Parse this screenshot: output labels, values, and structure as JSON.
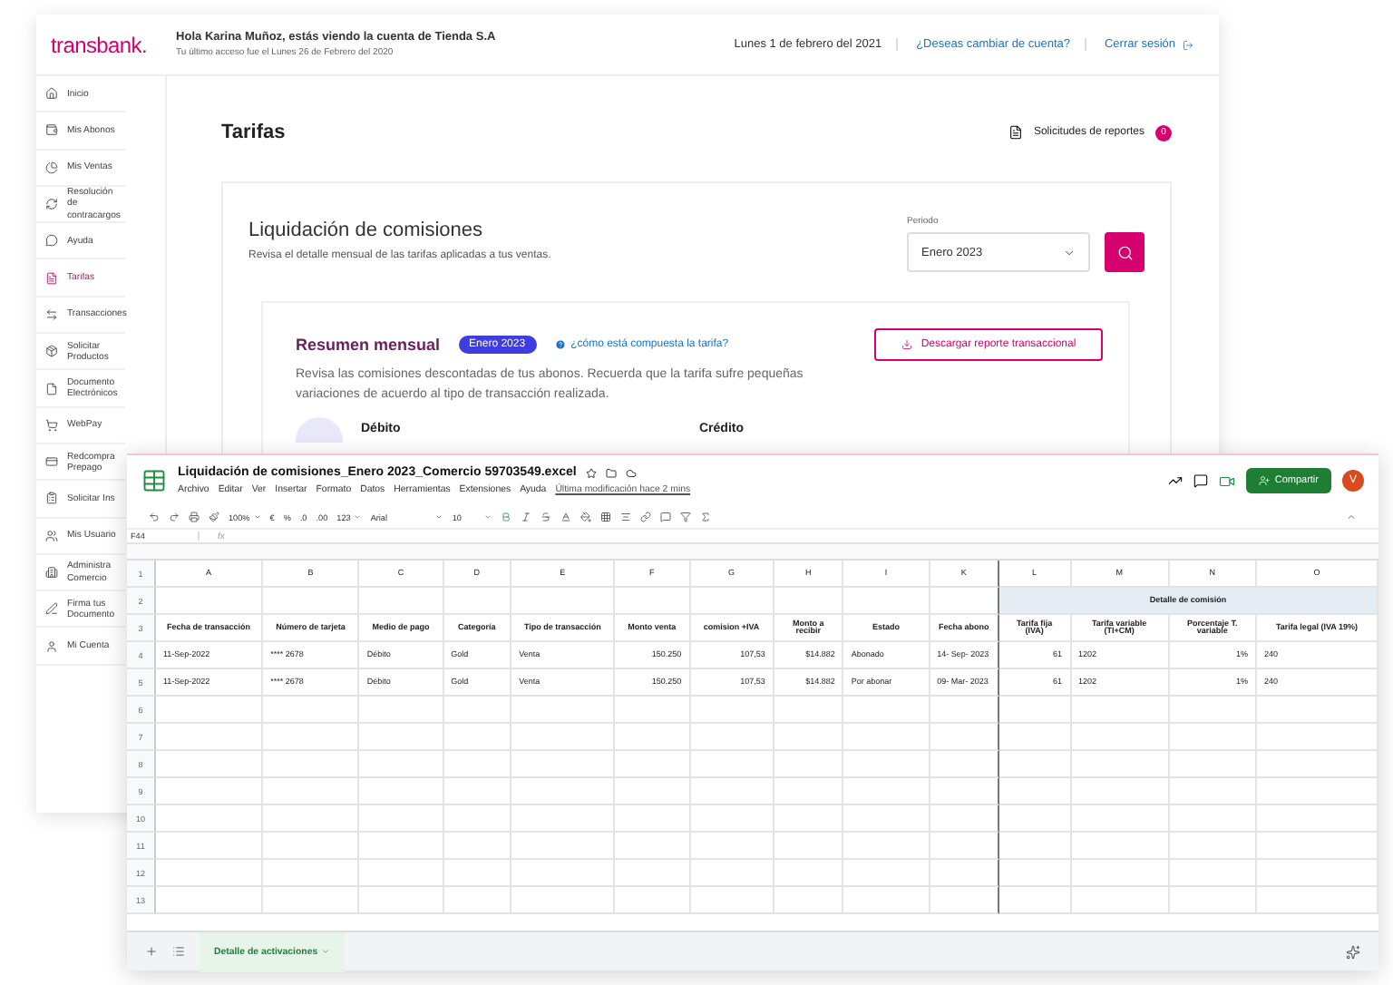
{
  "portal": {
    "logo": "transbank.",
    "greeting": "Hola Karina Muñoz, estás viendo la cuenta de Tienda S.A",
    "last_access": "Tu último acceso fue el Lunes 26 de Febrero del 2020",
    "date": "Lunes 1 de febrero del 2021",
    "switch_account": "¿Deseas cambiar de cuenta?",
    "logout": "Cerrar sesión",
    "sidebar": [
      {
        "label": "Inicio",
        "selected": false
      },
      {
        "label": "Mis Abonos",
        "selected": false
      },
      {
        "label": "Mis Ventas",
        "selected": false
      },
      {
        "label": "Resolución de contracargos",
        "selected": false
      },
      {
        "label": "Ayuda",
        "selected": false
      },
      {
        "label": "Tarifas",
        "selected": true
      },
      {
        "label": "Transacciones",
        "selected": false
      },
      {
        "label": "Solicitar Productos",
        "selected": false
      },
      {
        "label": "Documento Electrónicos",
        "selected": false
      },
      {
        "label": "WebPay",
        "selected": false
      },
      {
        "label": "Redcompra Prepago",
        "selected": false
      },
      {
        "label": "Solicitar Ins",
        "selected": false
      },
      {
        "label": "Mis Usuario",
        "selected": false
      },
      {
        "label": "Administra Comercio",
        "selected": false
      },
      {
        "label": "Firma tus Documento",
        "selected": false
      },
      {
        "label": "Mi Cuenta",
        "selected": false
      }
    ],
    "page_title": "Tarifas",
    "reports": {
      "label": "Solicitudes de reportes",
      "count": "0"
    },
    "card": {
      "title": "Liquidación de comisiones",
      "subtitle": "Revisa el detalle mensual de las tarifas aplicadas a tus ventas.",
      "period_label": "Periodo",
      "period_value": "Enero 2023"
    },
    "summary": {
      "title": "Resumen mensual",
      "badge": "Enero 2023",
      "help_link": "¿cómo está compuesta la tarifa?",
      "description": "Revisa las comisiones descontadas de tus abonos. Recuerda que la tarifa sufre pequeñas variaciones de acuerdo al tipo de transacción realizada.",
      "download_button": "Descargar reporte transaccional",
      "columns": [
        "Débito",
        "Crédito"
      ]
    }
  },
  "sheet": {
    "title": "Liquidación de comisiones_Enero 2023_Comercio 59703549.excel",
    "menus": [
      "Archivo",
      "Editar",
      "Ver",
      "Insertar",
      "Formato",
      "Datos",
      "Herramientas",
      "Extensiones",
      "Ayuda"
    ],
    "last_modified": "Última modificación hace 2 mins",
    "share_button": "Compartir",
    "avatar": "V",
    "toolbar": {
      "zoom": "100%",
      "currency": "€",
      "percent": "%",
      "decrease_decimals": ".0",
      "increase_decimals": ".00",
      "number_format": "123",
      "font": "Arial",
      "font_size": "10"
    },
    "name_box": "F44",
    "formula_label": "fx",
    "columns": [
      {
        "letter": "A",
        "kind": "text",
        "group": false
      },
      {
        "letter": "B",
        "kind": "text",
        "group": false
      },
      {
        "letter": "C",
        "kind": "text",
        "group": false
      },
      {
        "letter": "D",
        "kind": "text",
        "group": false
      },
      {
        "letter": "E",
        "kind": "text",
        "group": false
      },
      {
        "letter": "F",
        "kind": "number",
        "group": false
      },
      {
        "letter": "G",
        "kind": "number",
        "group": false
      },
      {
        "letter": "H",
        "kind": "number",
        "group": false
      },
      {
        "letter": "I",
        "kind": "text",
        "group": false
      },
      {
        "letter": "K",
        "kind": "text",
        "group": false
      },
      {
        "letter": "L",
        "kind": "number",
        "group": true
      },
      {
        "letter": "M",
        "kind": "text",
        "group": true
      },
      {
        "letter": "N",
        "kind": "number",
        "group": true
      },
      {
        "letter": "O",
        "kind": "text",
        "group": true
      }
    ],
    "rows": [
      {
        "num": "1",
        "kind": "letters"
      },
      {
        "num": "2",
        "kind": "group",
        "label": "Detalle de comisión"
      },
      {
        "num": "3",
        "kind": "header",
        "cells": [
          "Fecha de transacción",
          "Número de tarjeta",
          "Medio de pago",
          "Categoría",
          "Tipo de transacción",
          "Monto venta",
          "comision +IVA",
          "Monto a recibir",
          "Estado",
          "Fecha abono",
          "Tarifa fija (IVA)",
          "Tarifa variable (TI+CM)",
          "Porcentaje T. variable",
          "Tarifa legal (IVA 19%)"
        ]
      },
      {
        "num": "4",
        "kind": "data",
        "cells": [
          "11-Sep-2022",
          "**** 2678",
          "Débito",
          "Gold",
          "Venta",
          "150.250",
          "107,53",
          "$14.882",
          "Abonado",
          "14- Sep- 2023",
          "61",
          "1202",
          "1%",
          "240"
        ]
      },
      {
        "num": "5",
        "kind": "data",
        "cells": [
          "11-Sep-2022",
          "**** 2678",
          "Débito",
          "Gold",
          "Venta",
          "150.250",
          "107,53",
          "$14.882",
          "Por abonar",
          "09- Mar- 2023",
          "61",
          "1202",
          "1%",
          "240"
        ]
      },
      {
        "num": "6",
        "kind": "empty"
      },
      {
        "num": "7",
        "kind": "empty"
      },
      {
        "num": "8",
        "kind": "empty"
      },
      {
        "num": "9",
        "kind": "empty"
      },
      {
        "num": "10",
        "kind": "empty"
      },
      {
        "num": "11",
        "kind": "empty"
      },
      {
        "num": "12",
        "kind": "empty"
      },
      {
        "num": "13",
        "kind": "empty"
      }
    ],
    "sheet_tabs": [
      {
        "label": "Detalle de activaciones",
        "selected": true
      }
    ]
  }
}
